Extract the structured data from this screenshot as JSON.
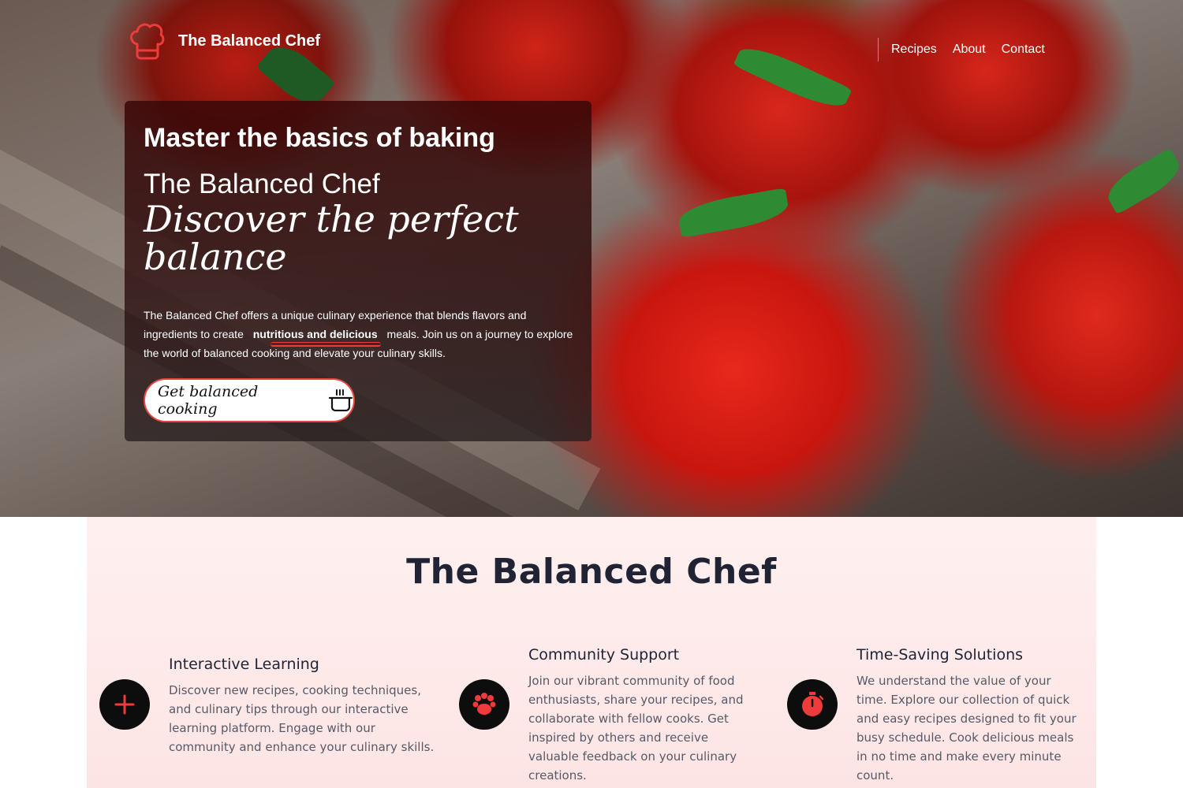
{
  "header": {
    "brand_name": "The Balanced Chef",
    "logo_icon": "chef-hat-icon",
    "nav": [
      {
        "label": "Recipes"
      },
      {
        "label": "About"
      },
      {
        "label": "Contact"
      }
    ]
  },
  "hero": {
    "kicker": "Master the basics of baking",
    "subtitle": "The Balanced Chef",
    "title": "Discover the perfect balance",
    "text_before": "The Balanced Chef offers a unique culinary experience that blends flavors and ingredients to create",
    "text_highlight": "nutritious and delicious",
    "text_after": "meals. Join us on a journey to explore the world of balanced cooking and elevate your culinary skills.",
    "cta_label": "Get balanced cooking",
    "cta_icon": "cooking-pot-icon",
    "background": "tomatoes-photo"
  },
  "features": {
    "title": "The Balanced Chef",
    "items": [
      {
        "title": "Interactive Learning",
        "text": "Discover new recipes, cooking techniques, and culinary tips through our interactive learning platform. Engage with our community and enhance your culinary skills.",
        "icon": "plus-icon"
      },
      {
        "title": "Community Support",
        "text": "Join our vibrant community of food enthusiasts, share your recipes, and collaborate with fellow cooks. Get inspired by others and receive valuable feedback on your culinary creations.",
        "icon": "paw-icon"
      },
      {
        "title": "Time-Saving Solutions",
        "text": "We understand the value of your time. Explore our collection of quick and easy recipes designed to fit your busy schedule. Cook delicious meals in no time and make every minute count.",
        "icon": "stopwatch-icon"
      }
    ]
  },
  "colors": {
    "accent": "#e8443d",
    "text_dark": "#1f2333",
    "section_bg": "#fde8e8",
    "icon_bg": "#0d0d0d"
  }
}
